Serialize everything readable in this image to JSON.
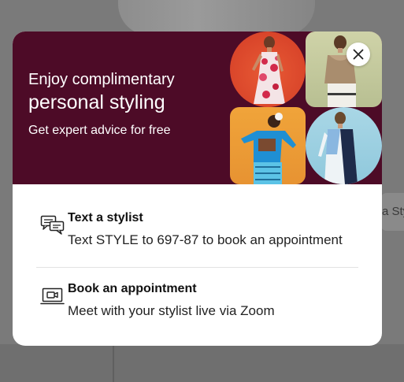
{
  "background": {
    "partial_tab_text": "a Sty"
  },
  "hero": {
    "line1": "Enjoy complimentary",
    "line2": "personal styling",
    "line3": "Get expert advice for free",
    "color": "#4d0b27"
  },
  "close_button": {
    "icon": "close-icon"
  },
  "options": [
    {
      "icon": "chat-bubbles-icon",
      "title": "Text a stylist",
      "description": "Text STYLE to 697-87 to book an appointment"
    },
    {
      "icon": "video-call-icon",
      "title": "Book an appointment",
      "description": "Meet with your stylist live via Zoom"
    }
  ]
}
